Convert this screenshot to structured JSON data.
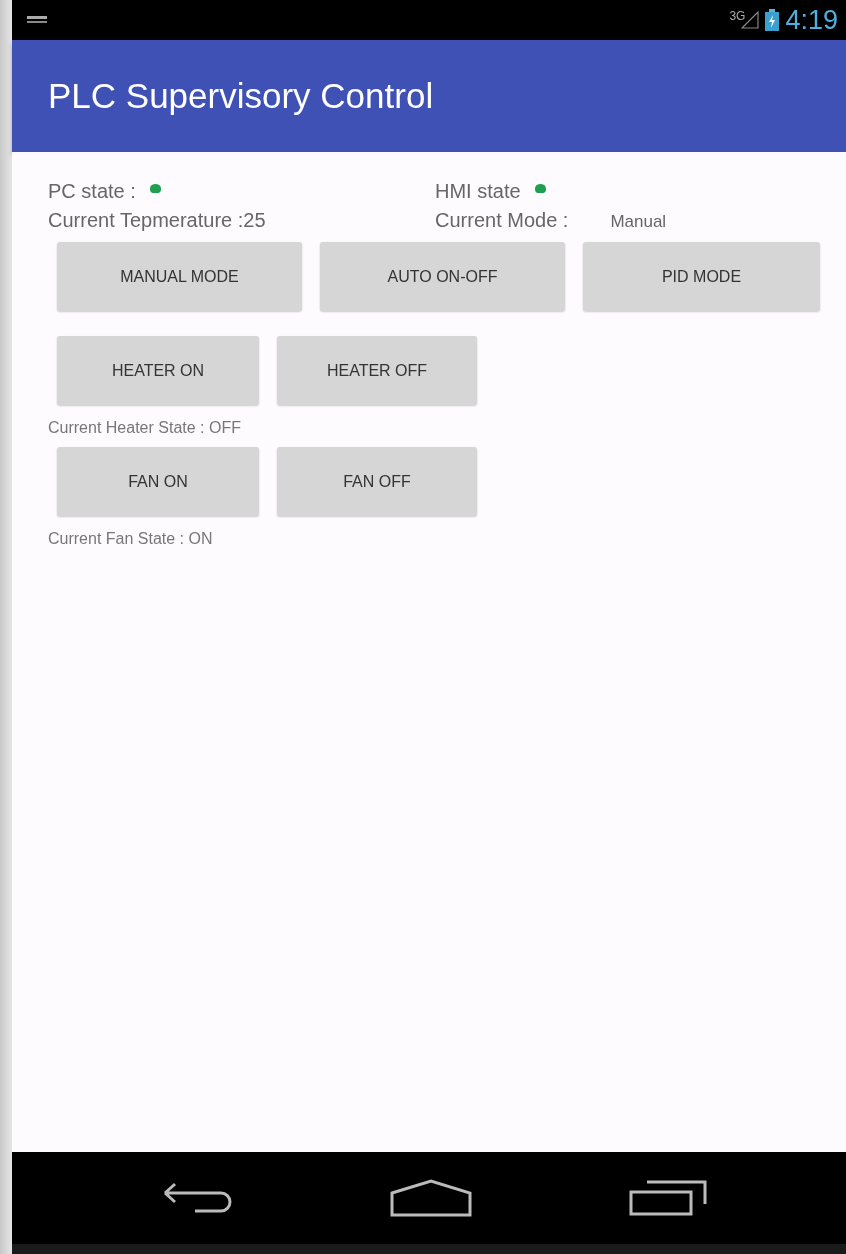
{
  "status_bar": {
    "network": "3G",
    "time": "4:19"
  },
  "app_bar": {
    "title": "PLC Supervisory Control"
  },
  "indicators": [
    {
      "label": "PC state :",
      "color": "#1fa050"
    },
    {
      "label": "HMI state",
      "color": "#1fa050"
    }
  ],
  "readings": [
    {
      "label": "Current Tepmerature :25"
    },
    {
      "label": "Current Mode :",
      "value": "Manual"
    }
  ],
  "mode_buttons": [
    "MANUAL MODE",
    "AUTO ON-OFF",
    "PID MODE"
  ],
  "heater": {
    "buttons": [
      "HEATER ON",
      "HEATER OFF"
    ],
    "state_text": "Current Heater State : OFF"
  },
  "fan": {
    "buttons": [
      "FAN ON",
      "FAN OFF"
    ],
    "state_text": "Current Fan State : ON"
  }
}
